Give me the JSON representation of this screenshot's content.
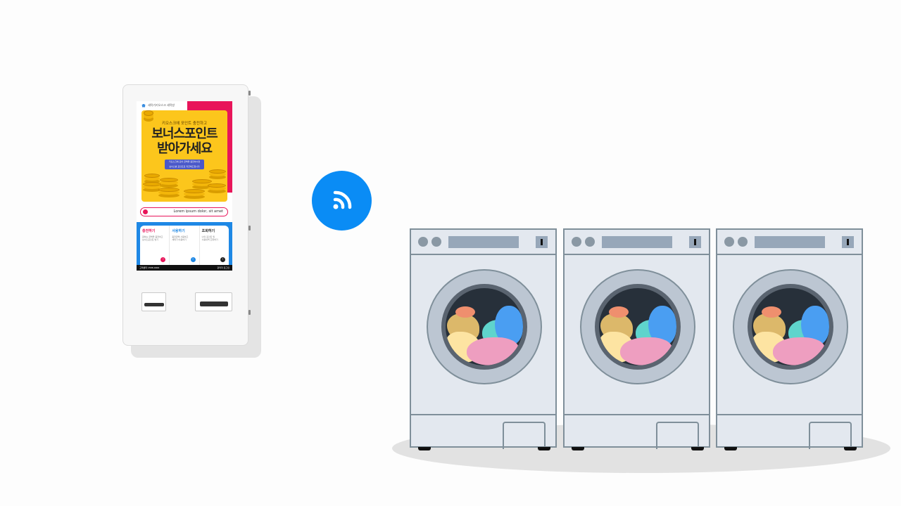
{
  "kiosk": {
    "header_text": "세탁기키오스크 세탁방",
    "banner": {
      "subtitle": "키오스크에 포인트 충전하고",
      "title_line1": "보너스포인트",
      "title_line2": "받아가세요",
      "pill_line1": "키오스크에 모아 금액을 충전하시면",
      "pill_line2": "보너스를 포인트로 지급해드립니다"
    },
    "search_text": "Lorem ipsum dolor, sit amet",
    "columns": [
      {
        "title": "충전하기",
        "desc_line1": "원하는 금액을 충전하고",
        "desc_line2": "보너스포인트 받기",
        "accent": "#e8155a"
      },
      {
        "title": "사용하기",
        "desc_line1": "충전금액 사용하고",
        "desc_line2": "세탁기 이용하기",
        "accent": "#1e88e5"
      },
      {
        "title": "조회하기",
        "desc_line1": "나의 포인트 및",
        "desc_line2": "사용내역 조회하기",
        "accent": "#222222"
      }
    ],
    "footer_left": "고객센터 1588-0000",
    "footer_right": "관리자 로그인"
  },
  "wifi": {
    "icon": "wifi-signal-icon",
    "color": "#0a8cf5"
  },
  "washers": {
    "count": 3
  }
}
